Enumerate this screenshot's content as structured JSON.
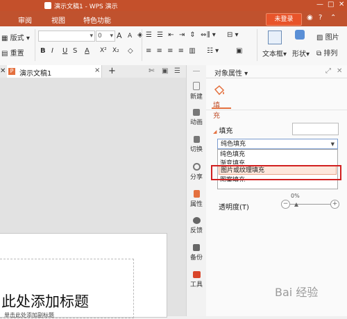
{
  "window": {
    "title": "演示文稿1 - WPS 演示"
  },
  "menu": {
    "items": [
      "审阅",
      "视图",
      "特色功能"
    ],
    "login": "未登录"
  },
  "ribbon": {
    "layout_label": "版式",
    "reset_label": "重置",
    "font_size": "0",
    "font_grow": "A",
    "font_shrink": "A",
    "textbox_label": "文本框",
    "shape_label": "形状",
    "picture_label": "图片",
    "arrange_label": "排列",
    "bold": "B",
    "italic": "I",
    "underline": "U",
    "strike": "S",
    "color": "A",
    "sup": "X²",
    "sub": "X₂"
  },
  "tab": {
    "doc_name": "演示文稿1",
    "close": "×",
    "add": "+"
  },
  "slide": {
    "title_text": "此处添加标题",
    "subtitle_text": "单击此处添加副标题"
  },
  "sidebar": {
    "items": [
      {
        "label": "新建"
      },
      {
        "label": "动画"
      },
      {
        "label": "切换"
      },
      {
        "label": "分享"
      },
      {
        "label": "属性"
      },
      {
        "label": "反馈"
      },
      {
        "label": "备份"
      },
      {
        "label": "工具"
      }
    ]
  },
  "panel": {
    "title": "对象属性",
    "fill_tab": "填充",
    "section": "填充",
    "selected": "纯色填充",
    "options": [
      "纯色填充",
      "渐变填充",
      "图片或纹理填充",
      "图案填充"
    ],
    "transparency_label": "透明度(T)",
    "transparency_value": "0%"
  },
  "watermark": "Bai 经验"
}
